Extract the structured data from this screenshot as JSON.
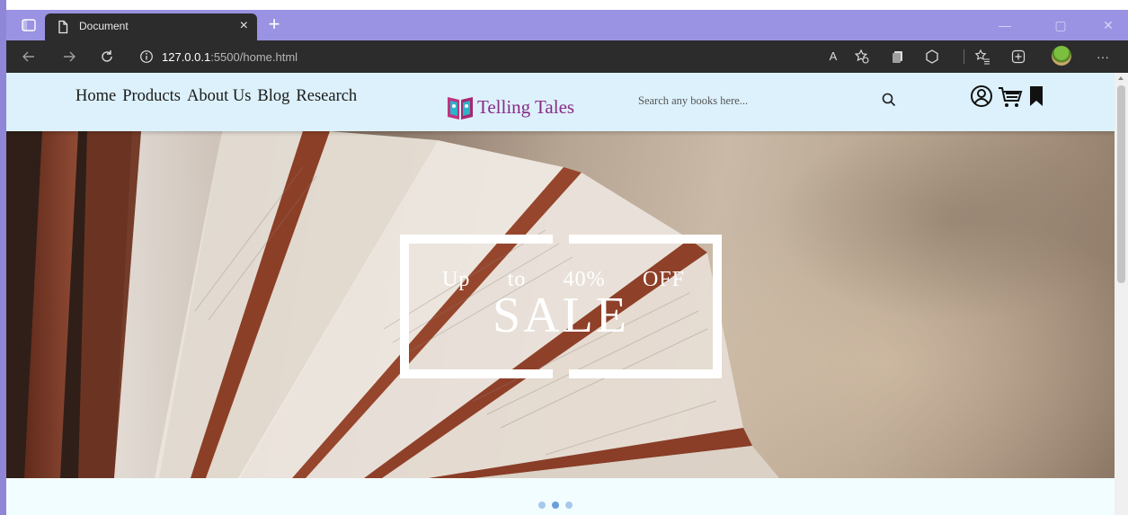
{
  "browser": {
    "tab_title": "Document",
    "tab_close": "×",
    "new_tab": "+",
    "url_host": "127.0.0.1",
    "url_rest": ":5500/home.html",
    "window_controls": [
      "—",
      "▢",
      "✕"
    ],
    "icons": [
      "tab-actions-icon",
      "document-icon",
      "back-icon",
      "forward-icon",
      "refresh-icon",
      "info-icon",
      "read-aloud-icon",
      "favorite-icon",
      "collections-icon",
      "extensions-icon",
      "favorites-list-icon",
      "collections-plus-icon",
      "profile-avatar",
      "more-icon"
    ],
    "read_aloud": "A",
    "more": "···"
  },
  "site": {
    "nav": [
      "Home",
      "Products",
      "About Us",
      "Blog",
      "Research"
    ],
    "logo_text": "Telling Tales",
    "logo_colors": {
      "accent": "#8b2a86",
      "book": "#c0337e"
    },
    "search_placeholder": "Search any books here...",
    "icons": [
      "search-icon",
      "user-icon",
      "cart-icon",
      "bookmark-icon"
    ],
    "header_bg": "#dcf1fb"
  },
  "hero": {
    "promo_words": [
      "Up",
      "to",
      "40%",
      "OFF"
    ],
    "promo_big": "SALE",
    "slide_count": 3,
    "active_slide": 2
  }
}
